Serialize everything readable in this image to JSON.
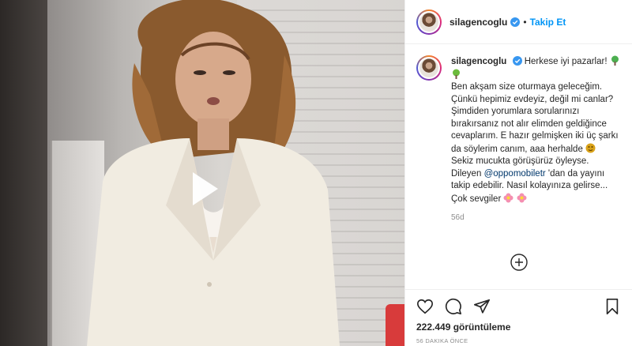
{
  "post": {
    "username": "silagencoglu",
    "follow_label": "Takip Et",
    "separator": "•"
  },
  "caption": {
    "username": "silagencoglu",
    "line1": "Herkese iyi pazarlar!",
    "line2": "Ben akşam size oturmaya geleceğim.",
    "line3": "Çünkü hepimiz evdeyiz, değil mi canlar?",
    "line4": "Şimdiden yorumlara sorularınızı bırakırsanız not alır elimden geldiğince cevaplarım. E hazır gelmişken iki üç şarkı da söylerim canım, aaa herhalde",
    "line5": "Sekiz mucukta görüşürüz öyleyse.",
    "line6_prefix": "Dileyen ",
    "mention": "@oppomobiletr",
    "line6_suffix": " 'dan da yayını takip edebilir. Nasıl kolayınıza gelirse...",
    "line7": "Çok sevgiler",
    "time": "56d"
  },
  "stats": {
    "views": "222.449 görüntüleme",
    "ago": "56 DAKIKA ÖNCE"
  },
  "icons": {
    "verified": "verified-badge-icon",
    "play": "play-icon",
    "add": "plus-circle-icon",
    "like": "heart-icon",
    "comment": "comment-icon",
    "share": "share-icon",
    "save": "bookmark-icon"
  },
  "colors": {
    "link": "#0095f6",
    "mention": "#00376b",
    "muted": "#8e8e8e",
    "text": "#262626"
  }
}
